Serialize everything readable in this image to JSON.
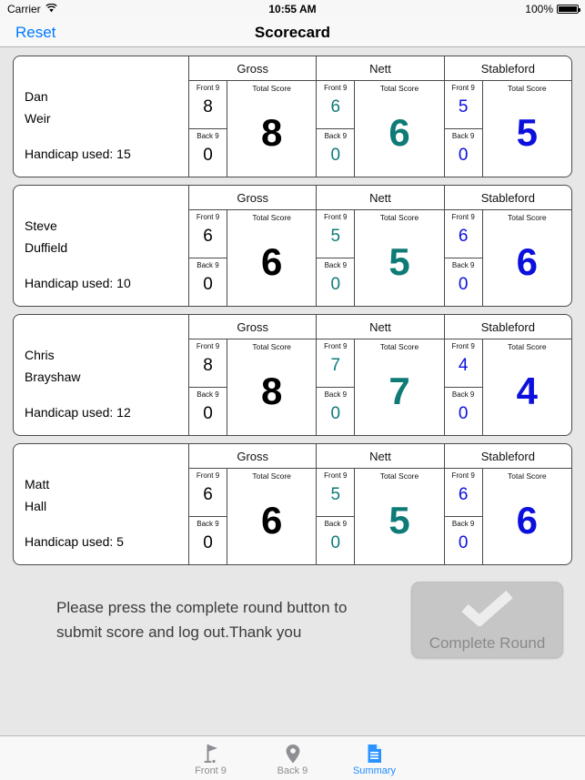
{
  "status_bar": {
    "carrier": "Carrier",
    "wifi_icon": "wifi-icon",
    "time": "10:55 AM",
    "battery_percent": "100%",
    "battery_icon": "battery-full-icon"
  },
  "nav_bar": {
    "reset_label": "Reset",
    "title": "Scorecard"
  },
  "colors": {
    "gross": "#000000",
    "nett": "#0e7b77",
    "stableford": "#0c10dd",
    "accent": "#007aff",
    "background": "#e7e7e7",
    "card_border": "#4a4a4a",
    "button_fill": "#c6c6c6"
  },
  "table": {
    "categories": [
      "Gross",
      "Nett",
      "Stableford"
    ],
    "half_labels": [
      "Front 9",
      "Back 9"
    ],
    "total_label": "Total Score",
    "handicap_prefix": "Handicap used: "
  },
  "players": [
    {
      "first_name": "Dan",
      "last_name": "Weir",
      "handicap_line": "Handicap used: 15",
      "gross": {
        "front": "8",
        "back": "0",
        "total": "8"
      },
      "nett": {
        "front": "6",
        "back": "0",
        "total": "6"
      },
      "stableford": {
        "front": "5",
        "back": "0",
        "total": "5"
      }
    },
    {
      "first_name": "Steve",
      "last_name": "Duffield",
      "handicap_line": "Handicap used: 10",
      "gross": {
        "front": "6",
        "back": "0",
        "total": "6"
      },
      "nett": {
        "front": "5",
        "back": "0",
        "total": "5"
      },
      "stableford": {
        "front": "6",
        "back": "0",
        "total": "6"
      }
    },
    {
      "first_name": "Chris",
      "last_name": "Brayshaw",
      "handicap_line": "Handicap used: 12",
      "gross": {
        "front": "8",
        "back": "0",
        "total": "8"
      },
      "nett": {
        "front": "7",
        "back": "0",
        "total": "7"
      },
      "stableford": {
        "front": "4",
        "back": "0",
        "total": "4"
      }
    },
    {
      "first_name": "Matt",
      "last_name": "Hall",
      "handicap_line": "Handicap used: 5",
      "gross": {
        "front": "6",
        "back": "0",
        "total": "6"
      },
      "nett": {
        "front": "5",
        "back": "0",
        "total": "5"
      },
      "stableford": {
        "front": "6",
        "back": "0",
        "total": "6"
      }
    }
  ],
  "footer": {
    "message": "Please press the complete round button to submit score and log out.Thank you",
    "button_label": "Complete Round",
    "button_icon": "checkmark-icon"
  },
  "tabs": [
    {
      "label": "Front 9",
      "icon": "golf-flag-icon",
      "active": false
    },
    {
      "label": "Back 9",
      "icon": "map-pin-icon",
      "active": false
    },
    {
      "label": "Summary",
      "icon": "document-icon",
      "active": true
    }
  ]
}
